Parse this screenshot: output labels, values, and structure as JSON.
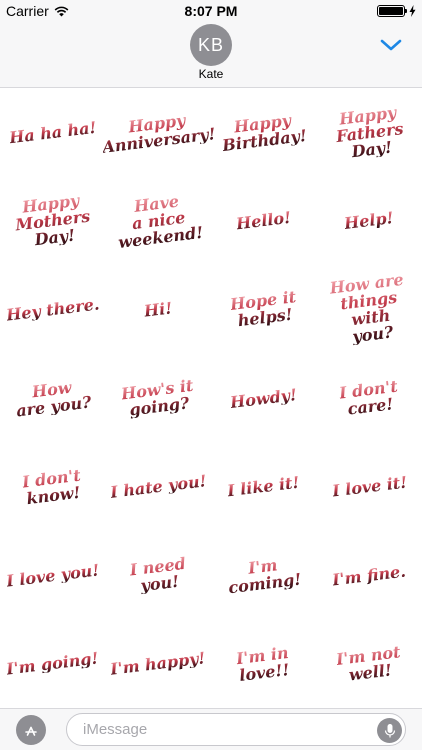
{
  "status_bar": {
    "carrier": "Carrier",
    "time": "8:07 PM",
    "battery_level": 1.0
  },
  "header": {
    "avatar_initials": "KB",
    "contact_name": "Kate",
    "collapse_icon": "chevron-down-icon",
    "accent_color": "#1e88e5"
  },
  "stickers": [
    "Ha ha ha!",
    "Happy\nAnniversary!",
    "Happy\nBirthday!",
    "Happy\nFathers Day!",
    "Happy\nMothers Day!",
    "Have\na nice\nweekend!",
    "Hello!",
    "Help!",
    "Hey there.",
    "Hi!",
    "Hope it\nhelps!",
    "How are\nthings with\nyou?",
    "How\nare you?",
    "How's it\ngoing?",
    "Howdy!",
    "I don't\ncare!",
    "I don't\nknow!",
    "I hate you!",
    "I like it!",
    "I love it!",
    "I love you!",
    "I need you!",
    "I'm coming!",
    "I'm fine.",
    "I'm going!",
    "I'm happy!",
    "I'm in\nlove!!",
    "I'm not\nwell!"
  ],
  "input_bar": {
    "placeholder": "iMessage",
    "app_store_icon": "app-store-icon",
    "mic_icon": "microphone-icon"
  }
}
